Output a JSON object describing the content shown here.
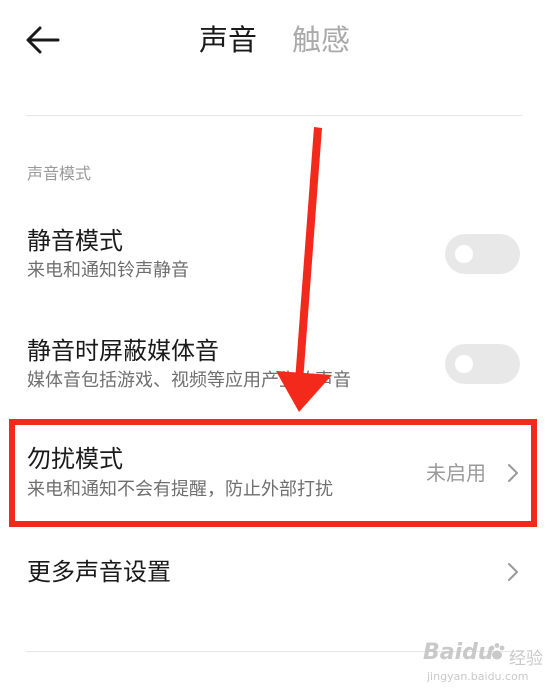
{
  "header": {
    "back_icon": "back-arrow-icon",
    "tabs": [
      {
        "label": "声音",
        "active": true
      },
      {
        "label": "触感",
        "active": false
      }
    ]
  },
  "section": {
    "title": "声音模式"
  },
  "settings": {
    "mute_mode": {
      "title": "静音模式",
      "subtitle": "来电和通知铃声静音",
      "enabled": false
    },
    "mute_media": {
      "title": "静音时屏蔽媒体音",
      "subtitle": "媒体音包括游戏、视频等应用产生的声音",
      "enabled": false
    },
    "dnd": {
      "title": "勿扰模式",
      "subtitle": "来电和通知不会有提醒，防止外部打扰",
      "value": "未启用"
    },
    "more": {
      "title": "更多声音设置"
    }
  },
  "colors": {
    "annotation_red": "#f2291b",
    "toggle_off": "#e8e8e8",
    "secondary_text": "#9a9a9a"
  },
  "watermark": {
    "brand": "Baidu",
    "sub": "经验",
    "url": "jingyan.baidu.com"
  }
}
